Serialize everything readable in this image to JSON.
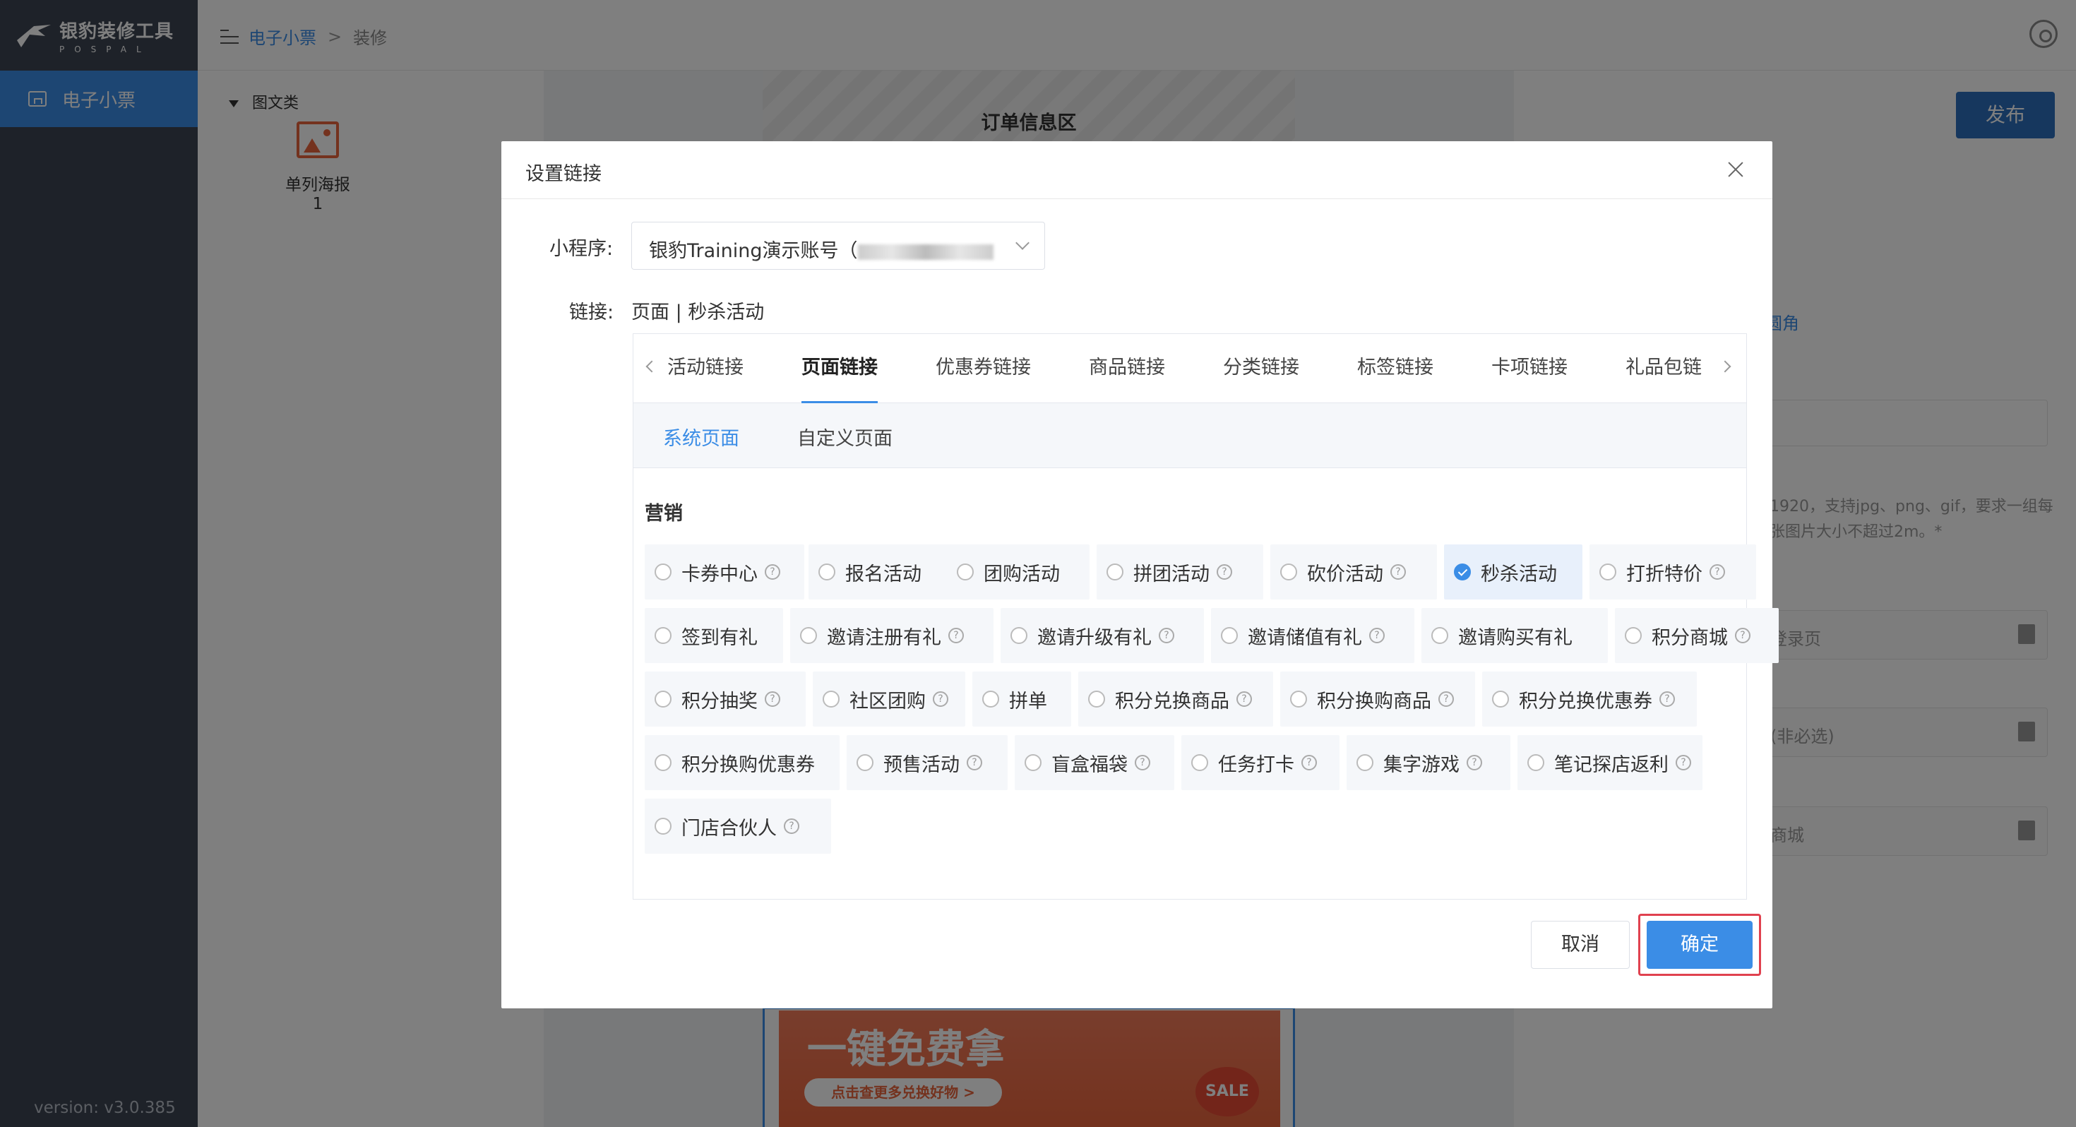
{
  "app": {
    "logo_title": "银豹装修工具",
    "logo_sub": "POSPAL",
    "version": "version: v3.0.385"
  },
  "sidebar": {
    "items": [
      {
        "label": "电子小票",
        "icon": "receipt-icon",
        "active": true
      }
    ]
  },
  "breadcrumb": {
    "items": [
      "电子小票",
      "装修"
    ]
  },
  "left_panel": {
    "category": "图文类",
    "widget_label": "单列海报",
    "widget_count": "1"
  },
  "canvas": {
    "section_title": "订单信息区",
    "banner_title": "一键免费拿",
    "banner_button": "点击查更多兑换好物 >",
    "banner_badge": "SALE"
  },
  "right_panel": {
    "publish_label": "发布",
    "blue_text": "圆角",
    "hint": "1920，支持jpg、png、gif，要求一组每张图片大小不超过2m。*",
    "inputs": [
      "登录页",
      "(非必选)",
      "商城"
    ]
  },
  "modal": {
    "title": "设置链接",
    "mini_program_label": "小程序:",
    "mini_program_value": "银豹Training演示账号（",
    "link_label": "链接:",
    "link_value": "页面 | 秒杀活动",
    "tabs": [
      "活动链接",
      "页面链接",
      "优惠券链接",
      "商品链接",
      "分类链接",
      "标签链接",
      "卡项链接",
      "礼品包链"
    ],
    "active_tab": "页面链接",
    "subtabs": [
      "系统页面",
      "自定义页面"
    ],
    "active_subtab": "系统页面",
    "section": "营销",
    "options": [
      {
        "label": "卡券中心",
        "help": true
      },
      {
        "label": "报名活动",
        "help": false
      },
      {
        "label": "团购活动",
        "help": false
      },
      {
        "label": "拼团活动",
        "help": true
      },
      {
        "label": "砍价活动",
        "help": true
      },
      {
        "label": "秒杀活动",
        "help": false,
        "selected": true
      },
      {
        "label": "打折特价",
        "help": true
      },
      {
        "label": "签到有礼",
        "help": false
      },
      {
        "label": "邀请注册有礼",
        "help": true
      },
      {
        "label": "邀请升级有礼",
        "help": true
      },
      {
        "label": "邀请储值有礼",
        "help": true
      },
      {
        "label": "邀请购买有礼",
        "help": false
      },
      {
        "label": "积分商城",
        "help": true
      },
      {
        "label": "积分抽奖",
        "help": true
      },
      {
        "label": "社区团购",
        "help": true
      },
      {
        "label": "拼单",
        "help": false
      },
      {
        "label": "积分兑换商品",
        "help": true
      },
      {
        "label": "积分换购商品",
        "help": true
      },
      {
        "label": "积分兑换优惠券",
        "help": true
      },
      {
        "label": "积分换购优惠券",
        "help": false
      },
      {
        "label": "预售活动",
        "help": true
      },
      {
        "label": "盲盒福袋",
        "help": true
      },
      {
        "label": "任务打卡",
        "help": true
      },
      {
        "label": "集字游戏",
        "help": true
      },
      {
        "label": "笔记探店返利",
        "help": true
      },
      {
        "label": "门店合伙人",
        "help": true
      }
    ],
    "cancel_label": "取消",
    "ok_label": "确定"
  },
  "colors": {
    "accent": "#3b8de6",
    "sidebar_bg": "#3c4553",
    "highlight_frame": "#e0414f"
  }
}
